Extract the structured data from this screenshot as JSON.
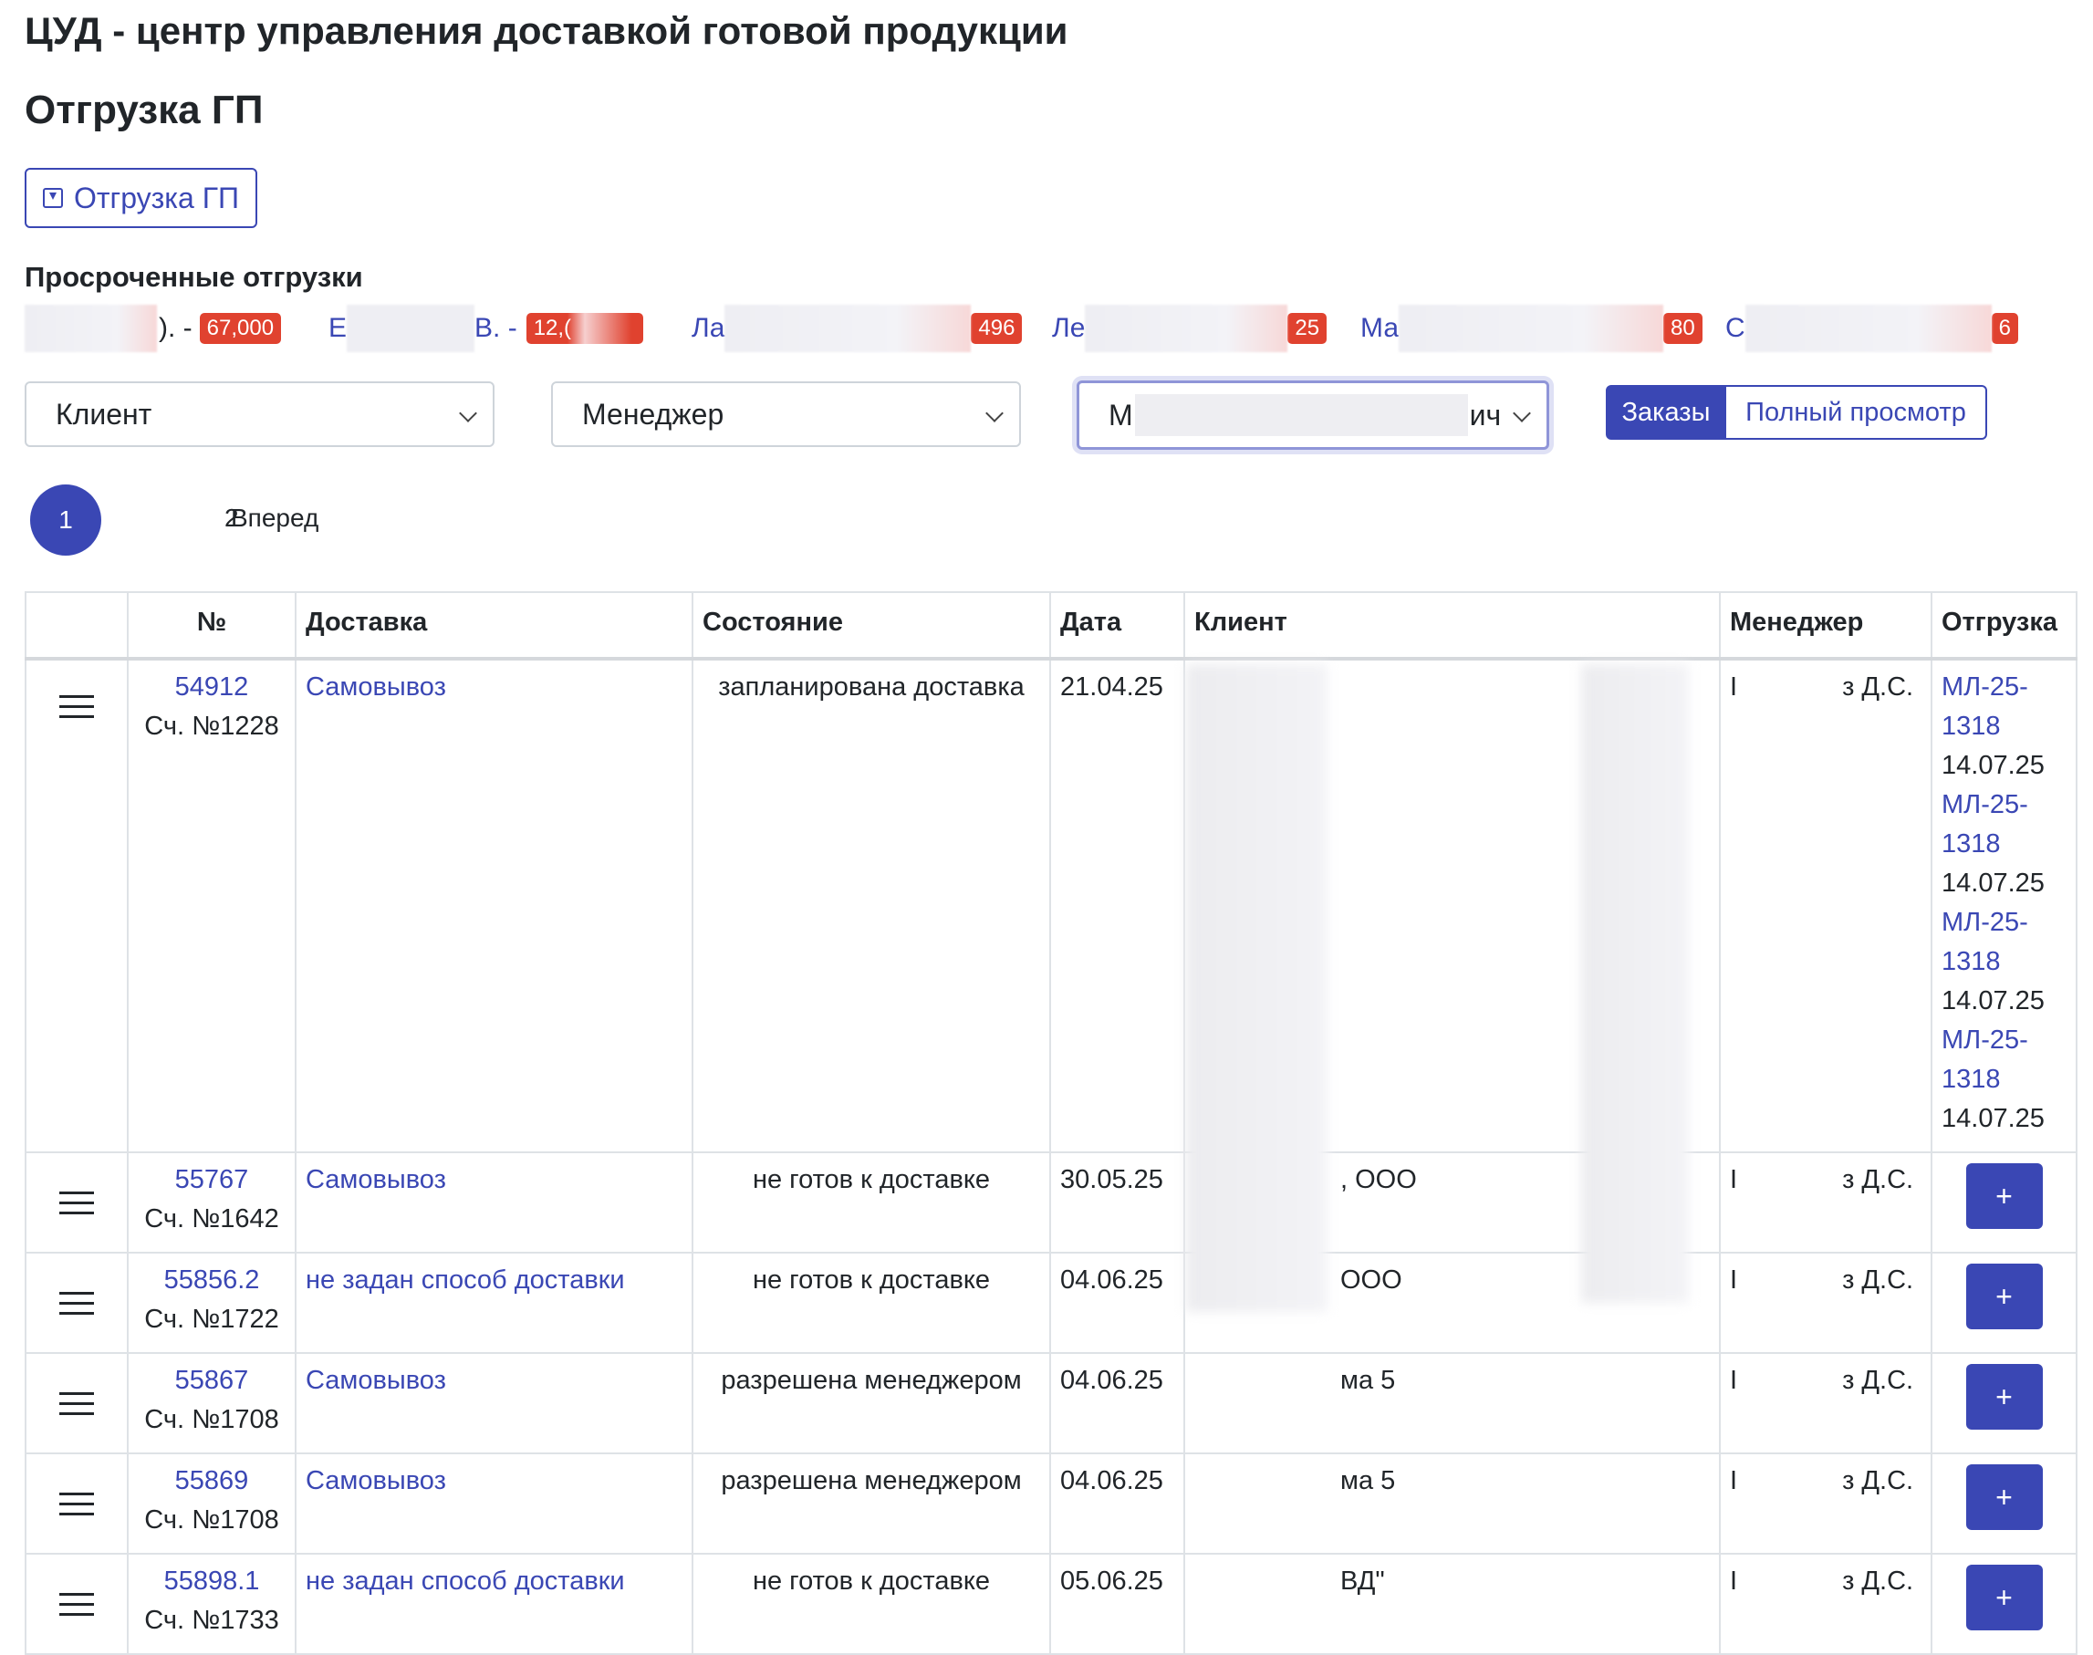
{
  "header": {
    "app_title": "ЦУД - центр управления доставкой готовой продукции",
    "page_title": "Отгрузка ГП",
    "action_button": "Отгрузка ГП"
  },
  "overdue": {
    "label": "Просроченные отгрузки",
    "items": [
      {
        "name": "). -",
        "badge": "67,000"
      },
      {
        "name": "Е",
        "name2": "В. -",
        "badge": "12,("
      },
      {
        "name": "Ла",
        "badge": "496"
      },
      {
        "name": "Ле",
        "badge": "25"
      },
      {
        "name": "Ма",
        "badge": "80"
      },
      {
        "name": "С",
        "badge": "6"
      }
    ]
  },
  "filters": {
    "client": "Клиент",
    "manager": "Менеджер",
    "third_prefix": "М",
    "third_suffix": "ич",
    "tab_orders": "Заказы",
    "tab_full": "Полный просмотр"
  },
  "pager": {
    "current": "1",
    "page2": "2",
    "next": "Вперед"
  },
  "table": {
    "headers": [
      "№",
      "Доставка",
      "Состояние",
      "Дата",
      "Клиент",
      "Менеджер",
      "Отгрузка"
    ],
    "rows": [
      {
        "num": "54912",
        "invoice": "Сч. №1228",
        "delivery": "Самовывоз",
        "state": "запланирована доставка",
        "date": "21.04.25",
        "client": "",
        "manager_a": "I",
        "manager_b": "з Д.С.",
        "shipments": [
          "МЛ-25-1318",
          "МЛ-25-1318",
          "МЛ-25-1318",
          "МЛ-25-1318"
        ],
        "ship_date": "14.07.25"
      },
      {
        "num": "55767",
        "invoice": "Сч. №1642",
        "delivery": "Самовывоз",
        "state": "не готов к доставке",
        "date": "30.05.25",
        "client": ", ООО",
        "manager_a": "I",
        "manager_b": "з Д.С.",
        "plus": "+"
      },
      {
        "num": "55856.2",
        "invoice": "Сч. №1722",
        "delivery": "не задан способ доставки",
        "state": "не готов к доставке",
        "date": "04.06.25",
        "client": "ООО",
        "manager_a": "I",
        "manager_b": "з Д.С.",
        "plus": "+"
      },
      {
        "num": "55867",
        "invoice": "Сч. №1708",
        "delivery": "Самовывоз",
        "state": "разрешена менеджером",
        "date": "04.06.25",
        "client": "ма 5",
        "manager_a": "I",
        "manager_b": "з Д.С.",
        "plus": "+"
      },
      {
        "num": "55869",
        "invoice": "Сч. №1708",
        "delivery": "Самовывоз",
        "state": "разрешена менеджером",
        "date": "04.06.25",
        "client": "ма 5",
        "manager_a": "I",
        "manager_b": "з Д.С.",
        "plus": "+"
      },
      {
        "num": "55898.1",
        "invoice": "Сч. №1733",
        "delivery": "не задан способ доставки",
        "state": "не готов к доставке",
        "date": "05.06.25",
        "client": "ВД\"",
        "manager_a": "I",
        "manager_b": "з Д.С.",
        "plus": "+"
      }
    ]
  },
  "colors": {
    "accent": "#3a47b4",
    "badge": "#e0422f"
  }
}
